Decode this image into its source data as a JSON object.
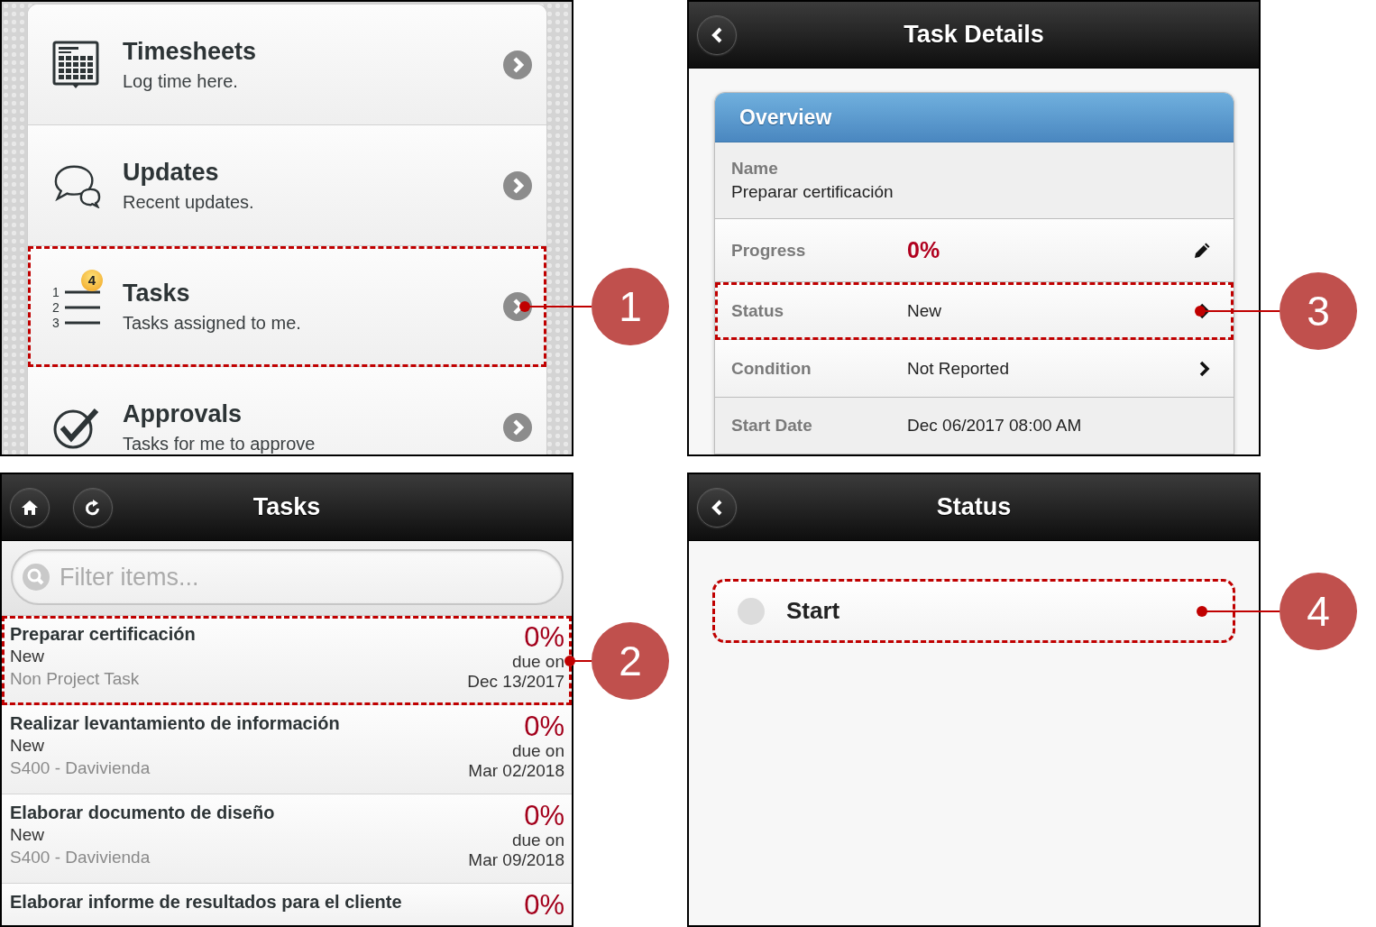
{
  "panels": [
    {
      "kind": "menu",
      "callout": "1",
      "items": [
        {
          "title": "Timesheets",
          "subtitle": "Log time here.",
          "highlighted": false
        },
        {
          "title": "Updates",
          "subtitle": "Recent updates.",
          "highlighted": false
        },
        {
          "title": "Tasks",
          "subtitle": "Tasks assigned to me.",
          "badge": "4",
          "list_icon_numbers": [
            "1",
            "2",
            "3"
          ],
          "highlighted": true
        },
        {
          "title": "Approvals",
          "subtitle": "Tasks for me to approve",
          "highlighted": false
        }
      ]
    },
    {
      "kind": "task_list",
      "callout": "2",
      "header": {
        "title": "Tasks",
        "buttons": [
          {
            "kind": "home"
          },
          {
            "kind": "refresh"
          }
        ]
      },
      "filter": {
        "placeholder": "Filter items..."
      },
      "tasks": [
        {
          "title": "Preparar certificación",
          "status": "New",
          "project": "Non Project Task",
          "progress": "0%",
          "due_label": "due on",
          "due_date": "Dec 13/2017",
          "highlighted": true
        },
        {
          "title": "Realizar levantamiento de información",
          "status": "New",
          "project": "S400 - Davivienda",
          "progress": "0%",
          "due_label": "due on",
          "due_date": "Mar 02/2018",
          "highlighted": false
        },
        {
          "title": "Elaborar documento de diseño",
          "status": "New",
          "project": "S400 - Davivienda",
          "progress": "0%",
          "due_label": "due on",
          "due_date": "Mar 09/2018",
          "highlighted": false
        },
        {
          "title": "Elaborar informe de resultados para el cliente",
          "progress": "0%",
          "highlighted": false
        }
      ]
    },
    {
      "kind": "task_details",
      "callout": "3",
      "header": {
        "title": "Task Details",
        "buttons": [
          {
            "kind": "back"
          }
        ]
      },
      "section": {
        "title": "Overview",
        "rows": [
          {
            "kind": "stacked",
            "label": "Name",
            "value": "Preparar certificación",
            "highlighted": false
          },
          {
            "kind": "edit",
            "label": "Progress",
            "value": "0%",
            "highlighted": false
          },
          {
            "kind": "link",
            "label": "Status",
            "value": "New",
            "highlighted": true
          },
          {
            "kind": "link",
            "label": "Condition",
            "value": "Not Reported",
            "highlighted": false
          },
          {
            "kind": "plain",
            "label": "Start Date",
            "value": "Dec 06/2017 08:00 AM",
            "highlighted": false
          }
        ]
      }
    },
    {
      "kind": "status_picker",
      "callout": "4",
      "header": {
        "title": "Status",
        "buttons": [
          {
            "kind": "back"
          }
        ]
      },
      "options": [
        {
          "label": "Start",
          "selected": false,
          "highlighted": true
        }
      ]
    }
  ]
}
